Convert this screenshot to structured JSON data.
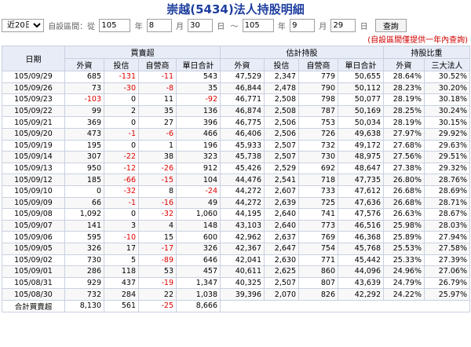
{
  "title": "崇越(5434)法人持股明細",
  "filter": {
    "range_selected": "近20日",
    "custom_label": "自設區間：從",
    "from_year": "105",
    "from_month": "8",
    "from_day": "30",
    "to_sep": "～",
    "to_year": "105",
    "to_month": "9",
    "to_day": "29",
    "year_unit": "年",
    "month_unit": "月",
    "day_unit": "日",
    "query_button": "查詢"
  },
  "note": "(自設區間僅提供一年內查詢)",
  "table": {
    "group_headers": {
      "date": "日期",
      "trade": "買賣超",
      "holdings": "估計持股",
      "ratio": "持股比重"
    },
    "columns": [
      "外資",
      "投信",
      "自營商",
      "單日合計",
      "外資",
      "投信",
      "自營商",
      "單日合計",
      "外資",
      "三大法人"
    ],
    "rows": [
      [
        "105/09/29",
        "685",
        "-131",
        "-11",
        "543",
        "47,529",
        "2,347",
        "779",
        "50,655",
        "28.64%",
        "30.52%"
      ],
      [
        "105/09/26",
        "73",
        "-30",
        "-8",
        "35",
        "46,844",
        "2,478",
        "790",
        "50,112",
        "28.23%",
        "30.20%"
      ],
      [
        "105/09/23",
        "-103",
        "0",
        "11",
        "-92",
        "46,771",
        "2,508",
        "798",
        "50,077",
        "28.19%",
        "30.18%"
      ],
      [
        "105/09/22",
        "99",
        "2",
        "35",
        "136",
        "46,874",
        "2,508",
        "787",
        "50,169",
        "28.25%",
        "30.24%"
      ],
      [
        "105/09/21",
        "369",
        "0",
        "27",
        "396",
        "46,775",
        "2,506",
        "753",
        "50,034",
        "28.19%",
        "30.15%"
      ],
      [
        "105/09/20",
        "473",
        "-1",
        "-6",
        "466",
        "46,406",
        "2,506",
        "726",
        "49,638",
        "27.97%",
        "29.92%"
      ],
      [
        "105/09/19",
        "195",
        "0",
        "1",
        "196",
        "45,933",
        "2,507",
        "732",
        "49,172",
        "27.68%",
        "29.63%"
      ],
      [
        "105/09/14",
        "307",
        "-22",
        "38",
        "323",
        "45,738",
        "2,507",
        "730",
        "48,975",
        "27.56%",
        "29.51%"
      ],
      [
        "105/09/13",
        "950",
        "-12",
        "-26",
        "912",
        "45,426",
        "2,529",
        "692",
        "48,647",
        "27.38%",
        "29.32%"
      ],
      [
        "105/09/12",
        "185",
        "-66",
        "-15",
        "104",
        "44,476",
        "2,541",
        "718",
        "47,735",
        "26.80%",
        "28.76%"
      ],
      [
        "105/09/10",
        "0",
        "-32",
        "8",
        "-24",
        "44,272",
        "2,607",
        "733",
        "47,612",
        "26.68%",
        "28.69%"
      ],
      [
        "105/09/09",
        "66",
        "-1",
        "-16",
        "49",
        "44,272",
        "2,639",
        "725",
        "47,636",
        "26.68%",
        "28.71%"
      ],
      [
        "105/09/08",
        "1,092",
        "0",
        "-32",
        "1,060",
        "44,195",
        "2,640",
        "741",
        "47,576",
        "26.63%",
        "28.67%"
      ],
      [
        "105/09/07",
        "141",
        "3",
        "4",
        "148",
        "43,103",
        "2,640",
        "773",
        "46,516",
        "25.98%",
        "28.03%"
      ],
      [
        "105/09/06",
        "595",
        "-10",
        "15",
        "600",
        "42,962",
        "2,637",
        "769",
        "46,368",
        "25.89%",
        "27.94%"
      ],
      [
        "105/09/05",
        "326",
        "17",
        "-17",
        "326",
        "42,367",
        "2,647",
        "754",
        "45,768",
        "25.53%",
        "27.58%"
      ],
      [
        "105/09/02",
        "730",
        "5",
        "-89",
        "646",
        "42,041",
        "2,630",
        "771",
        "45,442",
        "25.33%",
        "27.39%"
      ],
      [
        "105/09/01",
        "286",
        "118",
        "53",
        "457",
        "40,611",
        "2,625",
        "860",
        "44,096",
        "24.96%",
        "27.06%"
      ],
      [
        "105/08/31",
        "929",
        "437",
        "-19",
        "1,347",
        "40,325",
        "2,507",
        "807",
        "43,639",
        "24.79%",
        "26.79%"
      ],
      [
        "105/08/30",
        "732",
        "284",
        "22",
        "1,038",
        "39,396",
        "2,070",
        "826",
        "42,292",
        "24.22%",
        "25.97%"
      ]
    ],
    "total": {
      "label": "合計買賣超",
      "values": [
        "8,130",
        "561",
        "-25",
        "8,666"
      ]
    }
  }
}
